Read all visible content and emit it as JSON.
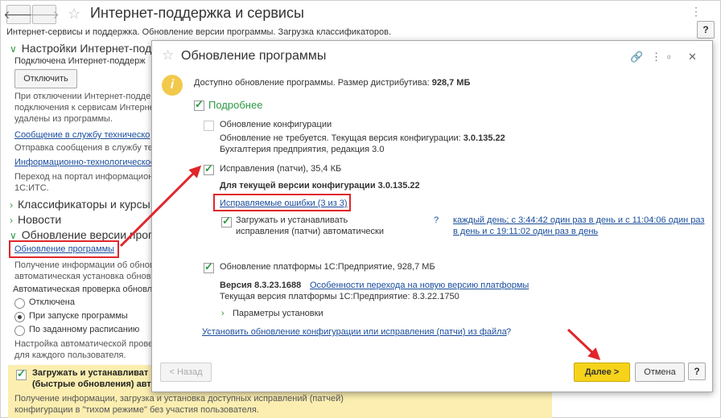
{
  "window": {
    "title": "Интернет-поддержка и сервисы",
    "subtitle": "Интернет-сервисы и поддержка. Обновление версии программы. Загрузка классификаторов.",
    "help_label": "?"
  },
  "left_panel": {
    "section_internet": "Настройки Интернет-подде",
    "connected_text": "Подключена Интернет-поддерж",
    "disconnect_label": "Отключить",
    "disconnect_note_1": "При отключении Интернет-подде",
    "disconnect_note_2": "подключения к сервисам Интернет",
    "disconnect_note_3": "удалены из программы.",
    "link_support": "Сообщение в службу техническо",
    "support_note": "Отправка сообщения в службу те",
    "link_it": "Информационно-технологическое",
    "it_note_1": "Переход на портал информацион",
    "it_note_2": "1С:ИТС.",
    "section_classifiers": "Классификаторы и курсы в",
    "section_news": "Новости",
    "section_updates": "Обновление версии програ",
    "link_update": "Обновление программы",
    "update_note_1": "Получение информации об обнов",
    "update_note_2": "автоматическая установка обнов",
    "auto_check_label": "Автоматическая проверка обновл",
    "radio_off": "Отключена",
    "radio_startup": "При запуске программы",
    "radio_schedule": "По заданному расписанию",
    "schedule_note_1": "Настройка автоматической провер",
    "schedule_note_2": "для каждого пользователя.",
    "bottom_check_1": "Загружать и устанавливат",
    "bottom_check_2": "(быстрые обновления) авт",
    "bottom_note_1": "Получение информации, загрузка и установка доступных  исправлений (патчей)",
    "bottom_note_2": "конфигурации в \"тихом режиме\" без  участия пользователя."
  },
  "dialog": {
    "title": "Обновление программы",
    "available_text": "Доступно обновление программы. Размер дистрибутива: ",
    "available_size": "928,7 МБ",
    "details_label": "Подробнее",
    "config": {
      "label": "Обновление конфигурации",
      "status": "Обновление не требуется. Текущая версия конфигурации: ",
      "version": "3.0.135.22",
      "edition": "Бухгалтерия предприятия, редакция 3.0"
    },
    "patches": {
      "label": "Исправления (патчи), 35,4 КБ",
      "for_version": "Для текущей версии конфигурации 3.0.135.22",
      "errors_link": "Исправляемые ошибки (3 из 3)",
      "auto_line_1": "Загружать и устанавливать",
      "auto_line_2": "исправления (патчи)  автоматически",
      "help": "?",
      "schedule_line_1": "каждый день; с 3:44:42 один раз в день и с 11:04:06 один раз",
      "schedule_line_2": "в день и с 19:11:02 один раз в день"
    },
    "platform": {
      "label": "Обновление платформы 1С:Предприятие, 928,7 МБ",
      "version": "Версия 8.3.23.1688",
      "features_link": "Особенности перехода на новую версию платформы",
      "current": "Текущая версия платформы 1С:Предприятие: 8.3.22.1750",
      "params_link": "Параметры установки"
    },
    "install_link": "Установить обновление конфигурации или исправления (патчи) из файла",
    "install_help": "?",
    "back_label": "< Назад",
    "next_label": "Далее >",
    "cancel_label": "Отмена",
    "help_label": "?"
  },
  "colors": {
    "accent_green": "#2e9a45",
    "link_blue": "#1a4d9c",
    "highlight_red": "#e0262a",
    "primary_yellow": "#f6d31a",
    "panel_yellow": "#fbeeb0"
  }
}
